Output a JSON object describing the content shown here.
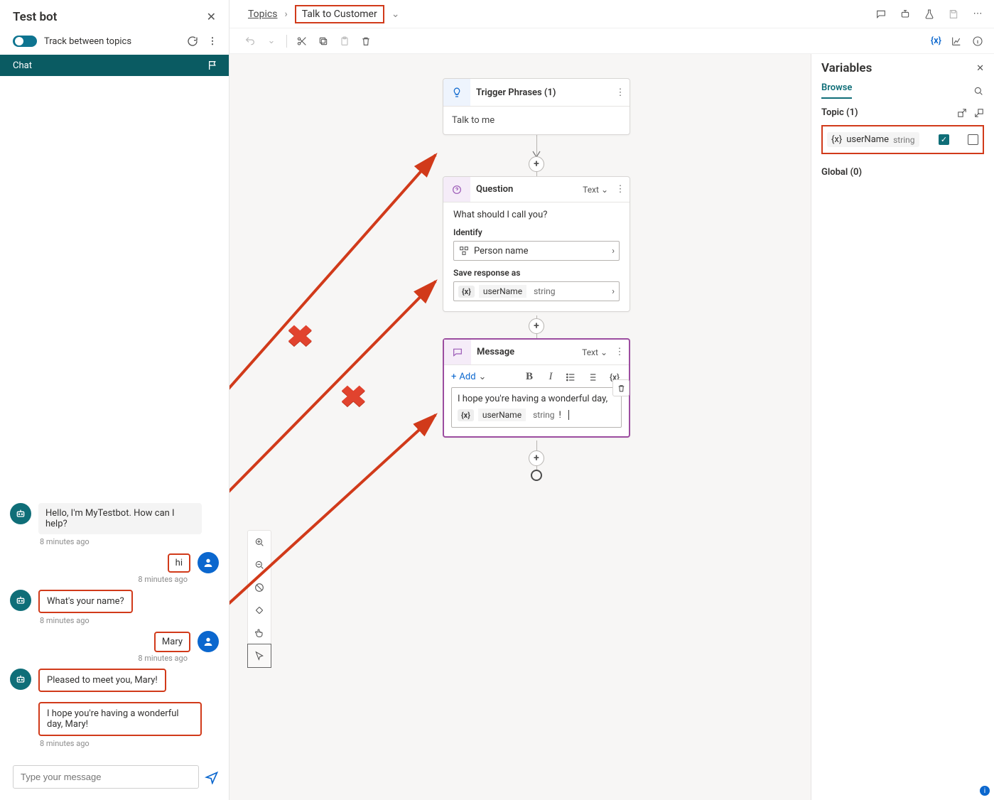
{
  "testbot": {
    "title": "Test bot",
    "track_label": "Track between topics",
    "chat_label": "Chat",
    "messages": [
      {
        "from": "bot",
        "text": "Hello, I'm MyTestbot. How can I help?",
        "time": "8 minutes ago"
      },
      {
        "from": "user",
        "text": "hi",
        "time": "8 minutes ago"
      },
      {
        "from": "bot",
        "text": "What's your name?",
        "time": "8 minutes ago"
      },
      {
        "from": "user",
        "text": "Mary",
        "time": "8 minutes ago"
      },
      {
        "from": "bot",
        "text": "Pleased to meet you, Mary!",
        "time": ""
      },
      {
        "from": "bot",
        "text": "I hope you're having a wonderful day, Mary!",
        "time": "8 minutes ago"
      }
    ],
    "input_placeholder": "Type your message"
  },
  "breadcrumb": {
    "root": "Topics",
    "current": "Talk to Customer"
  },
  "nodes": {
    "trigger": {
      "title": "Trigger Phrases (1)",
      "phrase": "Talk to me"
    },
    "question": {
      "title": "Question",
      "type": "Text",
      "prompt": "What should I call you?",
      "identify_label": "Identify",
      "identify_value": "Person name",
      "save_label": "Save response as",
      "var_name": "userName",
      "var_type": "string"
    },
    "message": {
      "title": "Message",
      "type": "Text",
      "add_label": "Add",
      "text": "I hope you're having a wonderful day,",
      "var_name": "userName",
      "var_type": "string",
      "trailing": "!"
    }
  },
  "variables": {
    "title": "Variables",
    "browse": "Browse",
    "topic_label": "Topic (1)",
    "global_label": "Global (0)",
    "items": [
      {
        "name": "userName",
        "type": "string",
        "receive": true,
        "return": false
      }
    ]
  },
  "var_token": "{x}"
}
